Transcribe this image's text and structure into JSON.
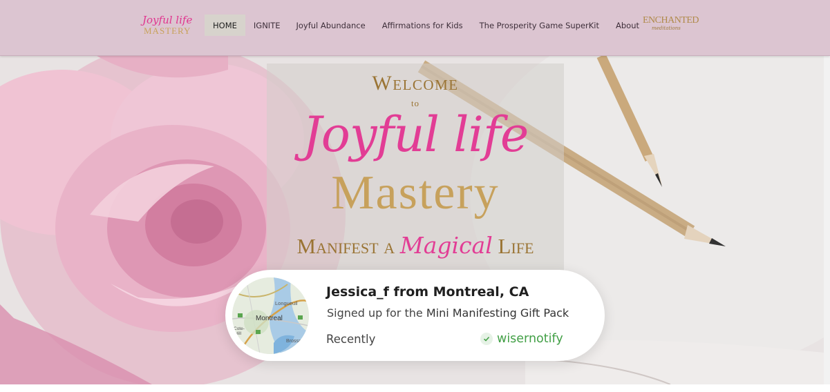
{
  "header": {
    "logo": {
      "line1": "Joyful life",
      "line2": "MASTERY"
    },
    "nav": [
      {
        "label": "HOME",
        "active": true
      },
      {
        "label": "IGNITE",
        "active": false
      },
      {
        "label": "Joyful Abundance",
        "active": false
      },
      {
        "label": "Affirmations for Kids",
        "active": false
      },
      {
        "label": "The Prosperity Game SuperKit",
        "active": false
      },
      {
        "label": "About",
        "active": false
      }
    ],
    "partner_logo": {
      "line1": "ENCHANTED",
      "line2": "meditations"
    }
  },
  "hero": {
    "welcome": "Welcome",
    "to": "to",
    "brand_line1": "Joyful life",
    "brand_line2": "Mastery",
    "tagline_start": "Manifest a",
    "tagline_magic": "Magical",
    "tagline_end": "Life"
  },
  "notification": {
    "title": "Jessica_f from Montreal, CA",
    "prefix": "Signed up for the",
    "product": "Mini Manifesting Gift Pack",
    "time": "Recently",
    "brand": "wisernotify",
    "map_labels": {
      "city": "Montreal",
      "north": "Longueuil",
      "west": "Cote-",
      "west2": "Hill",
      "south": "Brossa"
    }
  },
  "colors": {
    "header_bg": "#dcc5d1",
    "pink": "#e23d95",
    "gold": "#c7a15c",
    "brand_green": "#43a047"
  }
}
